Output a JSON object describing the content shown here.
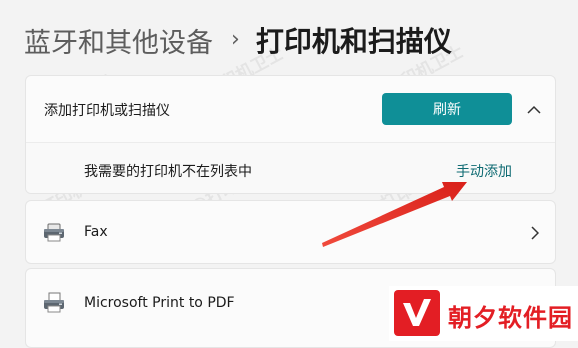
{
  "breadcrumb": {
    "parent": "蓝牙和其他设备",
    "separator": "›",
    "current": "打印机和扫描仪"
  },
  "add_device": {
    "title": "添加打印机或扫描仪",
    "refresh_label": "刷新",
    "collapse_icon": "chevron-up-icon",
    "missing_row_label": "我需要的打印机不在列表中",
    "manual_add_label": "手动添加"
  },
  "devices": [
    {
      "name": "Fax",
      "icon": "printer-icon"
    },
    {
      "name": "Microsoft Print to PDF",
      "icon": "pdf-printer-icon"
    }
  ],
  "watermark": {
    "text": "@打印机卫士"
  },
  "brand": {
    "name": "朝夕软件园"
  },
  "colors": {
    "accent": "#0f8f97",
    "link": "#0f6b73",
    "arrow": "#e8322b",
    "brand_red": "#e31e24"
  }
}
